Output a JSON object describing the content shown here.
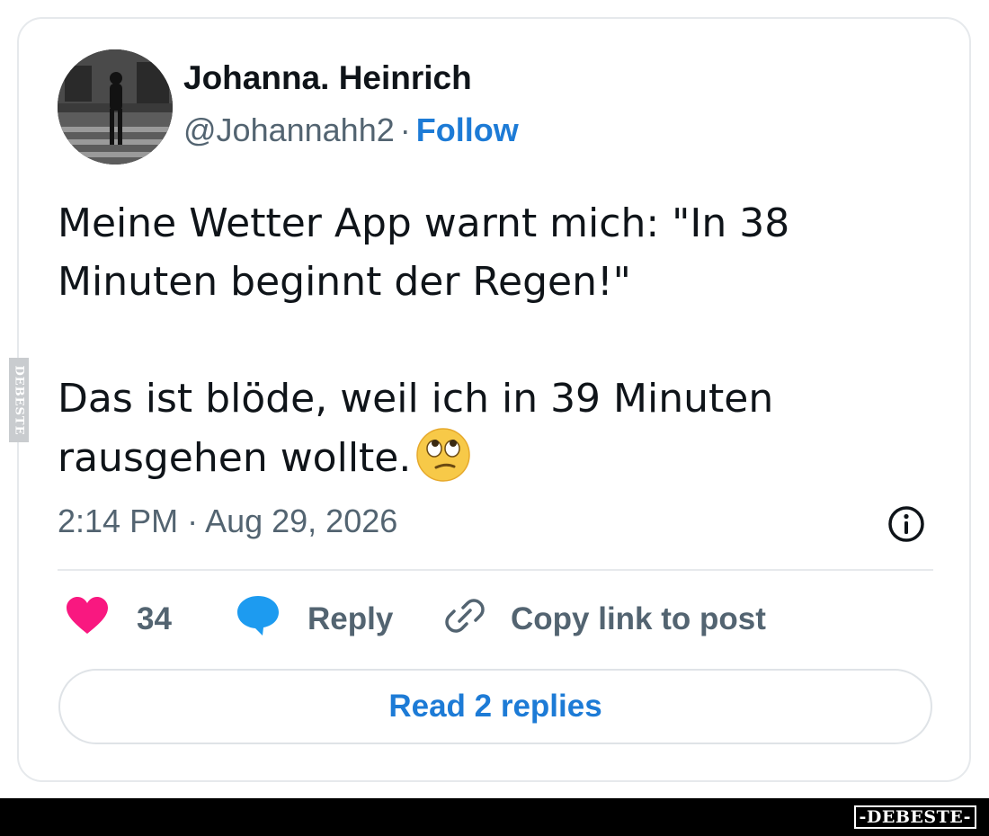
{
  "tweet": {
    "author": {
      "display_name": "Johanna. Heinrich",
      "handle": "@Johannahh2",
      "separator": "·",
      "follow_label": "Follow"
    },
    "text": {
      "paragraph_1": "Meine Wetter App warnt mich: \"In 38 Minuten beginnt der Regen!\"",
      "paragraph_2": "Das ist blöde, weil ich in 39 Minuten rausgehen wollte.",
      "emoji": "face-with-rolling-eyes"
    },
    "timestamp": "2:14 PM · Aug 29, 2026",
    "actions": {
      "like_count": "34",
      "reply_label": "Reply",
      "copy_link_label": "Copy link to post"
    },
    "read_replies_label": "Read 2 replies"
  },
  "watermark": {
    "side_text": "DEBESTE",
    "footer_text": "-DEBESTE-"
  },
  "icons": {
    "like": "heart-icon",
    "reply": "speech-bubble-icon",
    "copy_link": "link-icon",
    "info": "info-icon"
  },
  "colors": {
    "accent_blue": "#1d7bd6",
    "heart_pink": "#f91880",
    "reply_blue": "#1d9bf0",
    "secondary_text": "#536471",
    "primary_text": "#0f1419",
    "border": "#e6e9ec"
  }
}
